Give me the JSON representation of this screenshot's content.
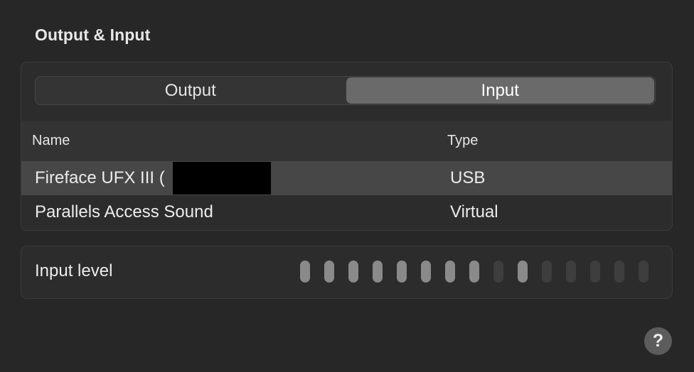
{
  "section": {
    "title": "Output & Input"
  },
  "tabs": {
    "output_label": "Output",
    "input_label": "Input",
    "selected": "Input"
  },
  "table": {
    "columns": {
      "name": "Name",
      "type": "Type"
    },
    "rows": [
      {
        "name": "Fireface UFX III (",
        "type": "USB",
        "selected": true
      },
      {
        "name": "Parallels Access Sound",
        "type": "Virtual",
        "selected": false
      }
    ]
  },
  "input_level": {
    "label": "Input level",
    "leds": [
      1,
      1,
      1,
      1,
      1,
      1,
      1,
      1,
      0,
      1,
      0,
      0,
      0,
      0,
      0
    ]
  },
  "help": {
    "label": "?"
  }
}
